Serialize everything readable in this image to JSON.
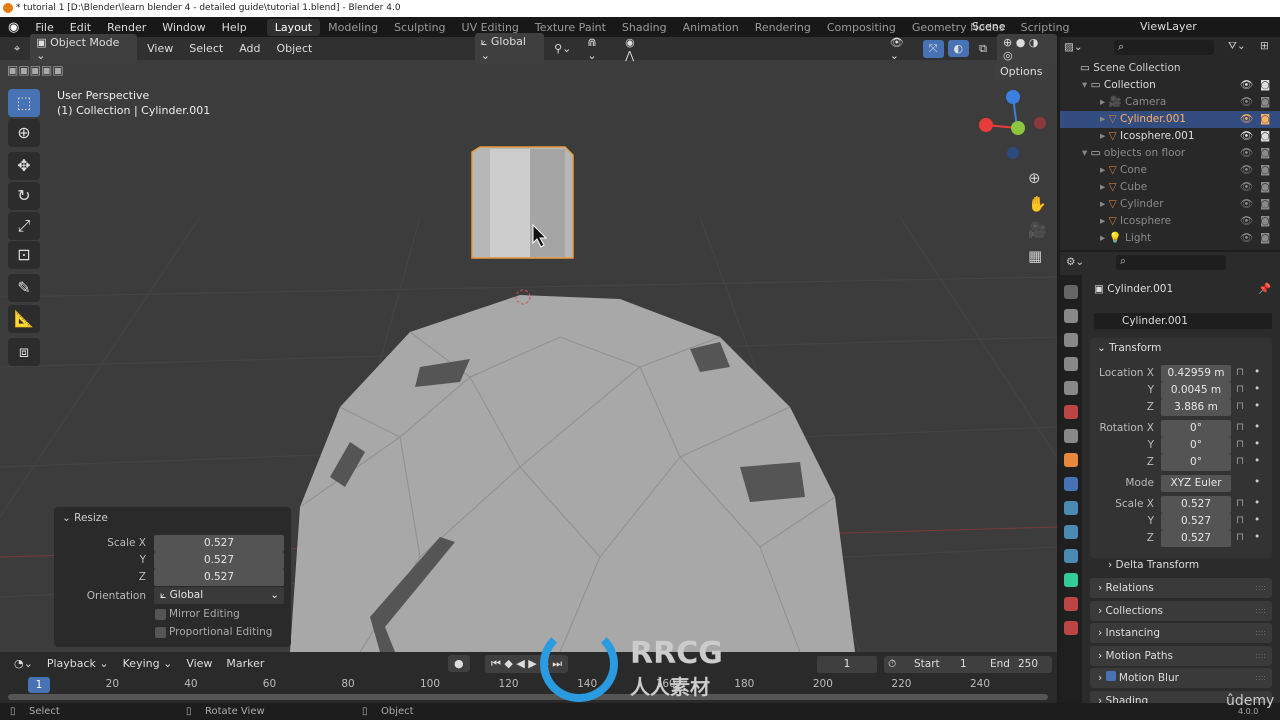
{
  "window": {
    "title": "* tutorial 1 [D:\\Blender\\learn blender 4 - detailed guide\\tutorial 1.blend] - Blender 4.0"
  },
  "menu": [
    "File",
    "Edit",
    "Render",
    "Window",
    "Help"
  ],
  "workspaces": [
    "Layout",
    "Modeling",
    "Sculpting",
    "UV Editing",
    "Texture Paint",
    "Shading",
    "Animation",
    "Rendering",
    "Compositing",
    "Geometry Nodes",
    "Scripting"
  ],
  "active_workspace": "Layout",
  "scene": "Scene",
  "view_layer": "ViewLayer",
  "viewport_header": {
    "mode": "Object Mode",
    "menus": [
      "View",
      "Select",
      "Add",
      "Object"
    ],
    "orientation": "Global",
    "options": "Options"
  },
  "viewport": {
    "perspective": "User Perspective",
    "collection_info": "(1) Collection | Cylinder.001",
    "gizmo_axes": [
      "X",
      "Y",
      "Z"
    ]
  },
  "tools": [
    "select-box",
    "cursor",
    "move",
    "rotate",
    "scale",
    "transform",
    "annotate",
    "measure",
    "add-cube"
  ],
  "resize_panel": {
    "title": "Resize",
    "scale_label": "Scale X",
    "y_label": "Y",
    "z_label": "Z",
    "scale": [
      "0.527",
      "0.527",
      "0.527"
    ],
    "orientation_label": "Orientation",
    "orientation": "Global",
    "mirror": "Mirror Editing",
    "proportional": "Proportional Editing"
  },
  "outliner": {
    "root": "Scene Collection",
    "items": [
      {
        "name": "Collection",
        "type": "collection",
        "level": 1
      },
      {
        "name": "Camera",
        "type": "camera",
        "level": 2,
        "dim": true
      },
      {
        "name": "Cylinder.001",
        "type": "mesh",
        "level": 2,
        "selected": true
      },
      {
        "name": "Icosphere.001",
        "type": "mesh",
        "level": 2
      },
      {
        "name": "objects on floor",
        "type": "collection",
        "level": 1,
        "dim": true
      },
      {
        "name": "Cone",
        "type": "mesh",
        "level": 2,
        "dim": true
      },
      {
        "name": "Cube",
        "type": "mesh",
        "level": 2,
        "dim": true
      },
      {
        "name": "Cylinder",
        "type": "mesh",
        "level": 2,
        "dim": true
      },
      {
        "name": "Icosphere",
        "type": "mesh",
        "level": 2,
        "dim": true
      },
      {
        "name": "Light",
        "type": "light",
        "level": 2,
        "dim": true
      }
    ]
  },
  "properties": {
    "object_name": "Cylinder.001",
    "datablock": "Cylinder.001",
    "transform": "Transform",
    "location_label": "Location X",
    "location": [
      "0.42959 m",
      "0.0045 m",
      "3.886 m"
    ],
    "rotation_label": "Rotation X",
    "rotation": [
      "0°",
      "0°",
      "0°"
    ],
    "mode_label": "Mode",
    "mode": "XYZ Euler",
    "scale_label": "Scale X",
    "scale": [
      "0.527",
      "0.527",
      "0.527"
    ],
    "y": "Y",
    "z": "Z",
    "delta": "Delta Transform",
    "panels": [
      "Relations",
      "Collections",
      "Instancing",
      "Motion Paths",
      "Motion Blur",
      "Shading"
    ]
  },
  "timeline": {
    "menus": [
      "Playback",
      "Keying",
      "View",
      "Marker"
    ],
    "current_frame": "1",
    "start_label": "Start",
    "start": "1",
    "end_label": "End",
    "end": "250",
    "ticks": [
      "20",
      "40",
      "60",
      "80",
      "100",
      "120",
      "140",
      "160",
      "180",
      "200",
      "220",
      "240"
    ]
  },
  "status": {
    "select": "Select",
    "rotate": "Rotate View",
    "object": "Object",
    "version": "4.0.0"
  },
  "watermark": {
    "brand": "RRCG",
    "sub": "人人素材",
    "udemy": "ûdemy"
  },
  "colors": {
    "accent": "#4772b3",
    "selection": "#e89a3c",
    "x_axis": "#e83c3c",
    "y_axis": "#8cc63f",
    "z_axis": "#3b7fe0"
  }
}
